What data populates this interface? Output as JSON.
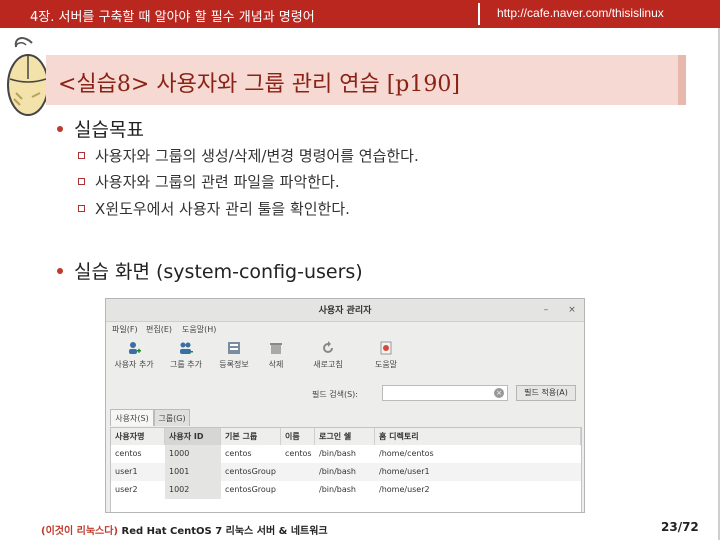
{
  "header": {
    "chapter": "4장. 서버를 구축할 때 알아야 할 필수 개념과 명령어",
    "url": "http://cafe.naver.com/thisislinux"
  },
  "slide": {
    "title": "<실습8> 사용자와 그룹 관리 연습 [p190]",
    "section1": {
      "heading": "실습목표",
      "items": [
        "사용자와 그룹의 생성/삭제/변경 명령어를 연습한다.",
        "사용자와 그룹의 관련 파일을 파악한다.",
        "X윈도우에서 사용자 관리 툴을 확인한다."
      ]
    },
    "section2": {
      "heading": "실습 화면 (system-config-users)"
    }
  },
  "screenshot": {
    "window_title": "사용자 관리자",
    "window_buttons": [
      "–",
      "×"
    ],
    "menu": [
      "파일(F)",
      "편집(E)",
      "도움말(H)"
    ],
    "toolbar": [
      {
        "label": "사용자 추가",
        "icon": "add-user-icon"
      },
      {
        "label": "그룹 추가",
        "icon": "add-group-icon"
      },
      {
        "label": "등록정보",
        "icon": "properties-icon"
      },
      {
        "label": "삭제",
        "icon": "delete-icon"
      },
      {
        "label": "새로고침",
        "icon": "refresh-icon"
      },
      {
        "label": "도움말",
        "icon": "help-icon"
      }
    ],
    "filter_label": "필드 검색(S):",
    "filter_value": "",
    "filter_button": "필드 적용(A)",
    "tabs": [
      "사용자(S)",
      "그룹(G)"
    ],
    "columns": [
      "사용자명",
      "사용자 ID",
      "기본 그룹",
      "이름",
      "로그인 쉘",
      "홈 디렉토리"
    ],
    "rows": [
      [
        "centos",
        "1000",
        "centos",
        "centos",
        "/bin/bash",
        "/home/centos"
      ],
      [
        "user1",
        "1001",
        "centosGroup",
        "",
        "/bin/bash",
        "/home/user1"
      ],
      [
        "user2",
        "1002",
        "centosGroup",
        "",
        "/bin/bash",
        "/home/user2"
      ]
    ]
  },
  "footer": {
    "book_prefix": "(이것이 리눅스다)",
    "book_rest": " Red Hat CentOS 7 리눅스 서버 & 네트워크",
    "page": "23/72"
  },
  "colors": {
    "banner": "#b9271f",
    "title_band": "#f5d9d2",
    "title_text": "#8a2215",
    "bullet": "#c0392b"
  }
}
